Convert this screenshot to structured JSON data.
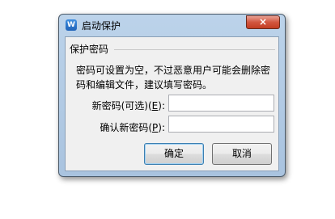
{
  "window": {
    "title": "启动保护",
    "app_icon_letter": "W",
    "close_symbol": "×"
  },
  "group": {
    "title": "保护密码"
  },
  "description": "密码可设置为空，不过恶意用户可能会删除密码和编辑文件，建议填写密码。",
  "fields": {
    "new_password": {
      "label_prefix": "新密码(可选)(",
      "mnemonic": "E",
      "label_suffix": "):",
      "value": ""
    },
    "confirm_password": {
      "label_prefix": "确认新密码(",
      "mnemonic": "P",
      "label_suffix": "):",
      "value": ""
    }
  },
  "buttons": {
    "ok": "确定",
    "cancel": "取消"
  }
}
